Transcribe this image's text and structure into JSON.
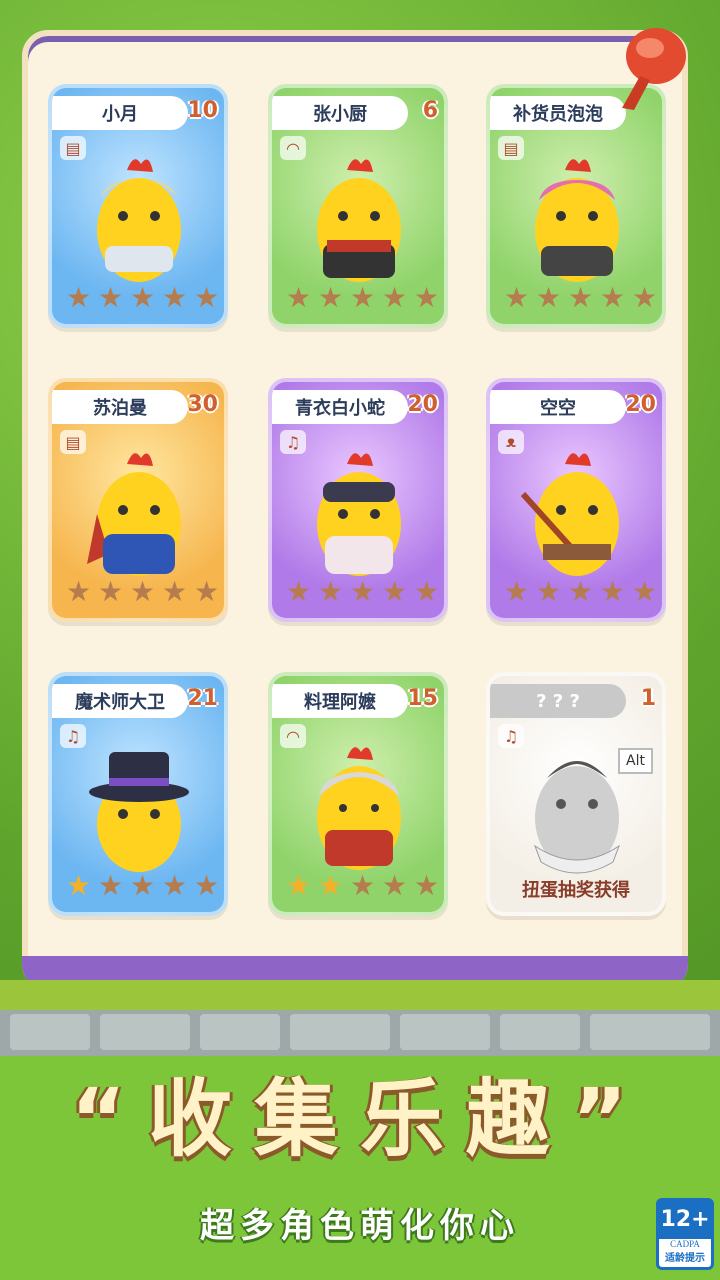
{
  "cards": [
    {
      "name": "小月",
      "count": "10",
      "type_icon": "cake-icon",
      "theme": "blue",
      "stars": 5
    },
    {
      "name": "张小厨",
      "count": "6",
      "type_icon": "bread-icon",
      "theme": "green",
      "stars": 5
    },
    {
      "name": "补货员泡泡",
      "count": "",
      "type_icon": "cake-icon",
      "theme": "green",
      "stars": 5
    },
    {
      "name": "苏泊曼",
      "count": "30",
      "type_icon": "cake-icon",
      "theme": "orange",
      "stars": 5
    },
    {
      "name": "青衣白小蛇",
      "count": "20",
      "type_icon": "music-icon",
      "theme": "purple",
      "stars": 5
    },
    {
      "name": "空空",
      "count": "20",
      "type_icon": "bear-icon",
      "theme": "purple",
      "stars": 5
    },
    {
      "name": "魔术师大卫",
      "count": "21",
      "type_icon": "music-icon",
      "theme": "blue",
      "stars": 5
    },
    {
      "name": "料理阿嬷",
      "count": "15",
      "type_icon": "bread-icon",
      "theme": "green",
      "stars": 5
    },
    {
      "name": "? ? ?",
      "count": "1",
      "type_icon": "music-icon",
      "theme": "gray",
      "stars": 0,
      "unlock_text": "扭蛋抽奖获得",
      "tooltip": "Alt"
    }
  ],
  "headline": "“收集乐趣”",
  "subline": "超多角色萌化你心",
  "age_rating": {
    "label": "12+",
    "org": "CADPA",
    "note": "适龄提示"
  },
  "colors": {
    "star": "#b57c4e",
    "star_on": "#f4b028",
    "headline": "#fff2c6"
  }
}
